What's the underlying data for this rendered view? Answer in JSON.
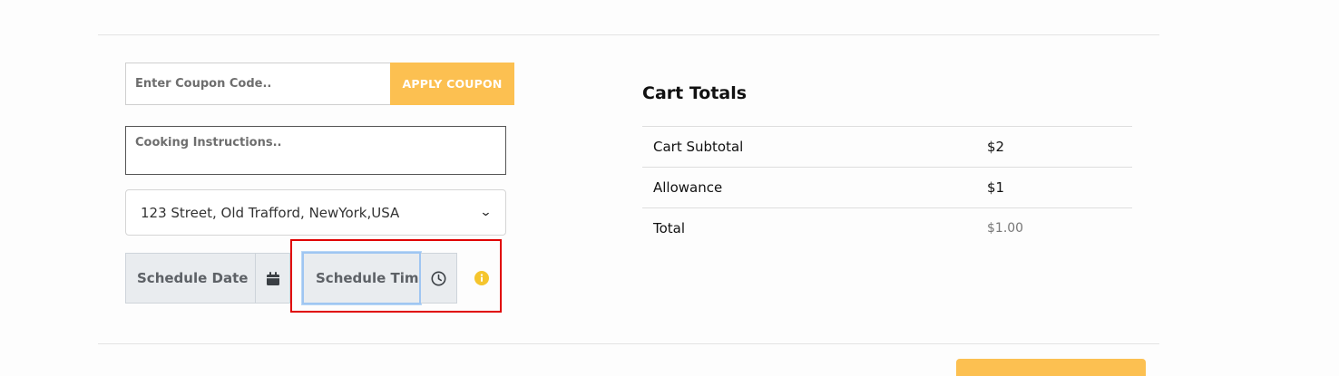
{
  "coupon": {
    "placeholder": "Enter Coupon Code..",
    "apply_label": "APPLY COUPON"
  },
  "cooking_instructions": {
    "placeholder": "Cooking Instructions.."
  },
  "address_select": {
    "selected": "123 Street, Old Trafford, NewYork,USA"
  },
  "schedule": {
    "date_label": "Schedule Date",
    "time_placeholder": "Schedule Time"
  },
  "cart_totals": {
    "title": "Cart Totals",
    "rows": [
      {
        "label": "Cart Subtotal",
        "value": "$2"
      },
      {
        "label": "Allowance",
        "value": "$1"
      },
      {
        "label": "Total",
        "value": "$1.00"
      }
    ]
  },
  "colors": {
    "accent": "#fcc051",
    "highlight": "#e00000",
    "info": "#f5c52d"
  },
  "icons": [
    "calendar-icon",
    "clock-icon",
    "info-icon",
    "chevron-down-icon"
  ]
}
